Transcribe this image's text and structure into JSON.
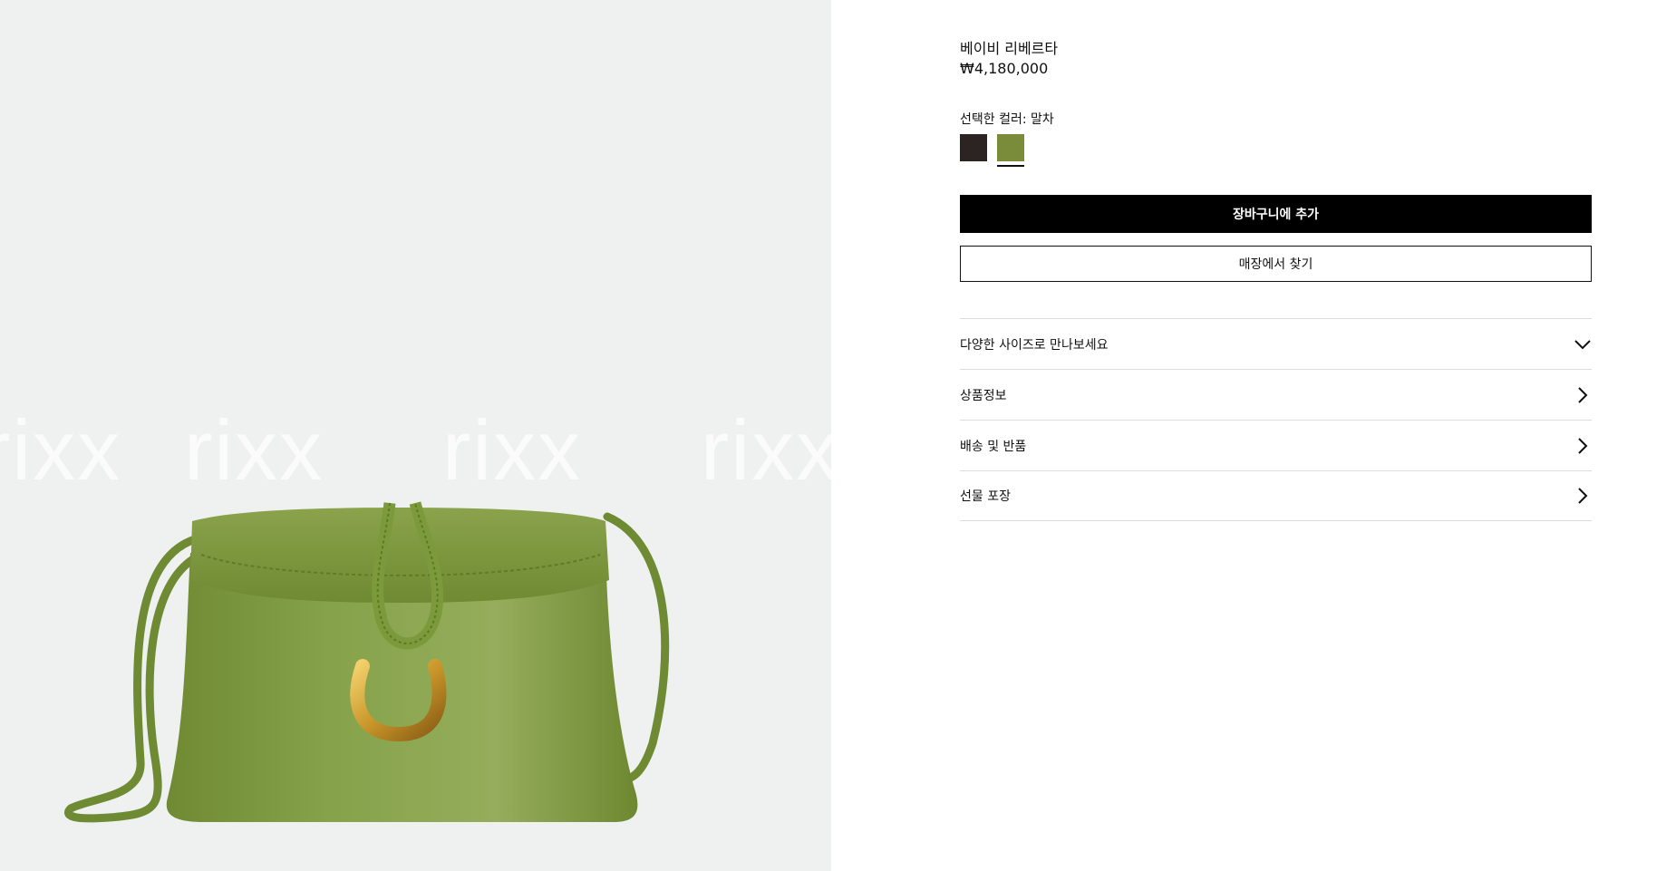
{
  "product": {
    "name": "베이비 리베르타",
    "price": "₩4,180,000",
    "color_label": "선택한 컬러: 말차"
  },
  "colors": [
    {
      "name": "dark",
      "hex": "#2b2422",
      "selected": false
    },
    {
      "name": "matcha",
      "hex": "#7a8c3a",
      "selected": true
    }
  ],
  "watermark": "rixx",
  "buttons": {
    "add_to_cart": "장바구니에 추가",
    "find_store": "매장에서 찾기"
  },
  "accordion": [
    {
      "label": "다양한 사이즈로 만나보세요",
      "icon": "chevron-down-icon"
    },
    {
      "label": "상품정보",
      "icon": "chevron-right-icon"
    },
    {
      "label": "배송 및 반품",
      "icon": "chevron-right-icon"
    },
    {
      "label": "선물 포장",
      "icon": "chevron-right-icon"
    }
  ],
  "theme": {
    "image_bg": "#eff1f0",
    "bag_green": "#7d9a3c",
    "hardware_gold": "#c8962a"
  }
}
